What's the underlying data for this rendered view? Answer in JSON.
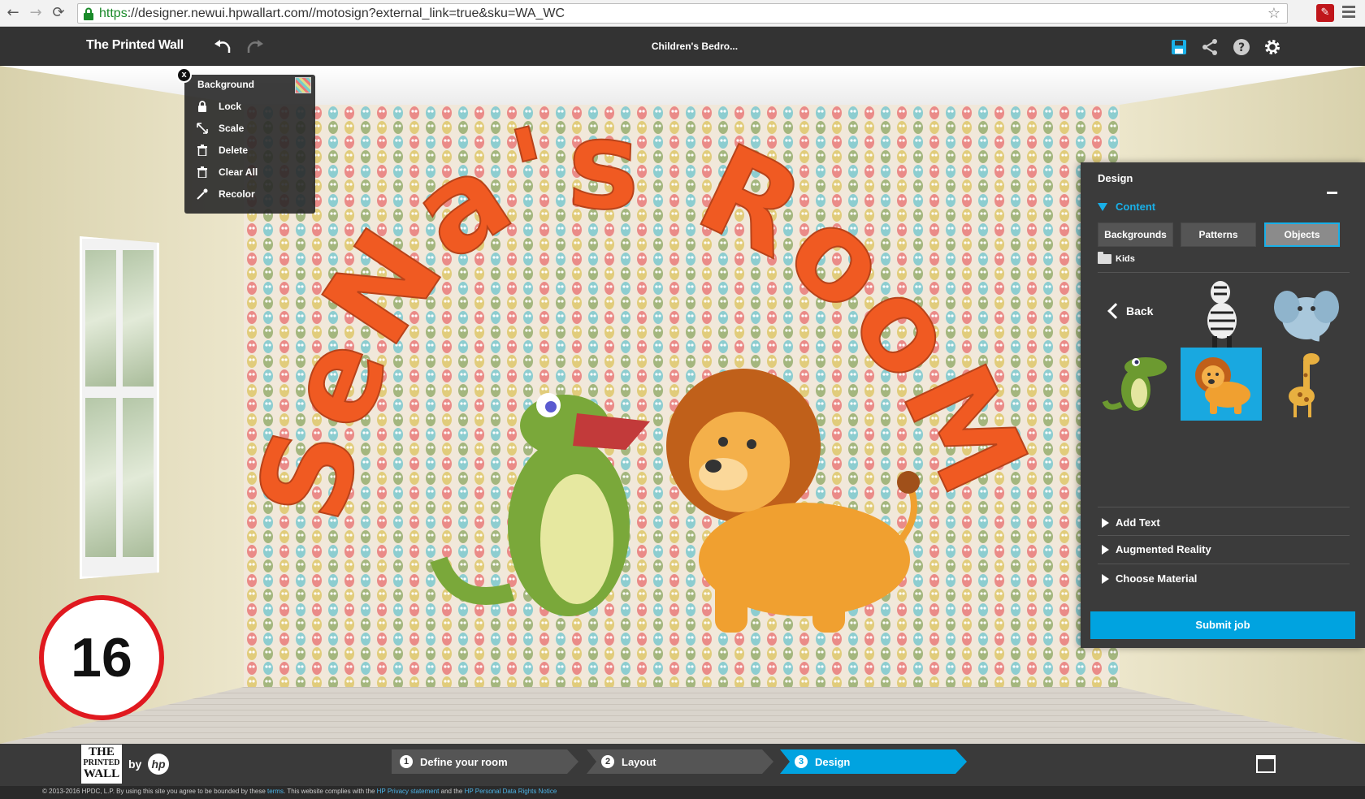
{
  "browser": {
    "url_scheme": "https",
    "url_rest": "://designer.newui.hpwallart.com//motosign?external_link=true&sku=WA_WC"
  },
  "header": {
    "brand": "The Printed Wall",
    "title": "Children's Bedro..."
  },
  "context_menu": {
    "title": "Background",
    "close": "x",
    "items": [
      {
        "label": "Lock",
        "icon": "lock-icon"
      },
      {
        "label": "Scale",
        "icon": "scale-icon"
      },
      {
        "label": "Delete",
        "icon": "trash-icon"
      },
      {
        "label": "Clear All",
        "icon": "trash-icon"
      },
      {
        "label": "Recolor",
        "icon": "eyedropper-icon"
      }
    ]
  },
  "wall_text": "SeNa's RooM",
  "design_panel": {
    "title": "Design",
    "content_label": "Content",
    "tabs": [
      {
        "label": "Backgrounds",
        "active": false
      },
      {
        "label": "Patterns",
        "active": false
      },
      {
        "label": "Objects",
        "active": true
      }
    ],
    "folder": "Kids",
    "back_label": "Back",
    "objects": [
      "zebra",
      "elephant",
      "crocodile",
      "lion",
      "giraffe"
    ],
    "selected_object": "lion",
    "sections": [
      "Add Text",
      "Augmented Reality",
      "Choose Material"
    ],
    "submit_label": "Submit job"
  },
  "step_badge": "16",
  "footer": {
    "logo_lines": [
      "THE",
      "PRINTED",
      "WALL"
    ],
    "by": "by",
    "hp": "hp",
    "steps": [
      {
        "num": "1",
        "label": "Define your room",
        "active": false
      },
      {
        "num": "2",
        "label": "Layout",
        "active": false
      },
      {
        "num": "3",
        "label": "Design",
        "active": true
      }
    ]
  },
  "copyright": {
    "text1": "© 2013-2016 HPDC, L.P.  By using this site you agree to be bounded by these",
    "terms": "terms",
    "text2": ". This website complies with the",
    "privacy": "HP Privacy statement",
    "text3": "and the",
    "rights": "HP Personal Data Rights Notice"
  },
  "colors": {
    "accent": "#00a3e0",
    "badge_ring": "#e0191f",
    "wall_text": "#f05a22"
  }
}
